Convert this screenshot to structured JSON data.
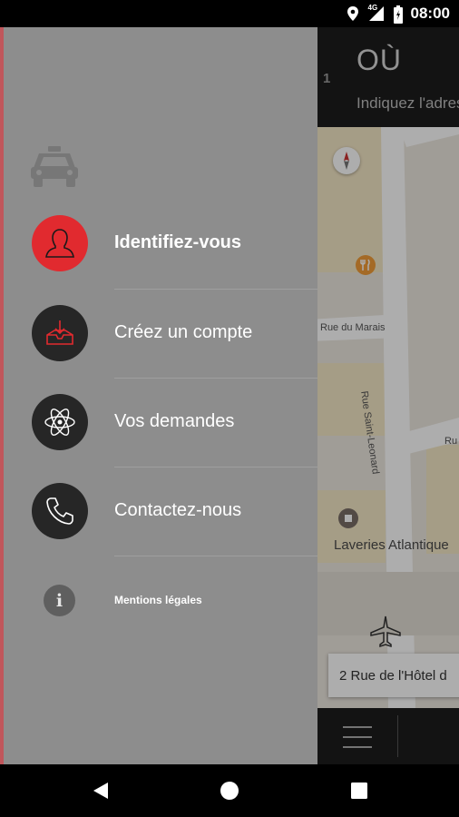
{
  "status_bar": {
    "time": "08:00",
    "network": "4G",
    "icons": [
      "location-icon",
      "signal-icon",
      "battery-icon"
    ]
  },
  "app": {
    "badge_count": "1",
    "where_title": "OÙ",
    "address_hint": "Indiquez l'adress",
    "map_labels": {
      "rue_marais": "Rue du Marais",
      "rue_saint_leonard": "Rue Saint-Leonard",
      "rue_partial": "Ru",
      "laveries": "Laveries Atlantique"
    },
    "address_card": "2 Rue de l'Hôtel d"
  },
  "drawer": {
    "items": [
      {
        "label": "Identifiez-vous",
        "icon": "user-icon"
      },
      {
        "label": "Créez un compte",
        "icon": "inbox-download-icon"
      },
      {
        "label": "Vos demandes",
        "icon": "atom-icon"
      },
      {
        "label": "Contactez-nous",
        "icon": "phone-icon"
      }
    ],
    "legal": {
      "label": "Mentions légales",
      "icon": "info-icon"
    }
  },
  "colors": {
    "drawer_bg": "#8d8d8d",
    "accent_red": "#e12a2f",
    "dark_circle": "#262626"
  }
}
